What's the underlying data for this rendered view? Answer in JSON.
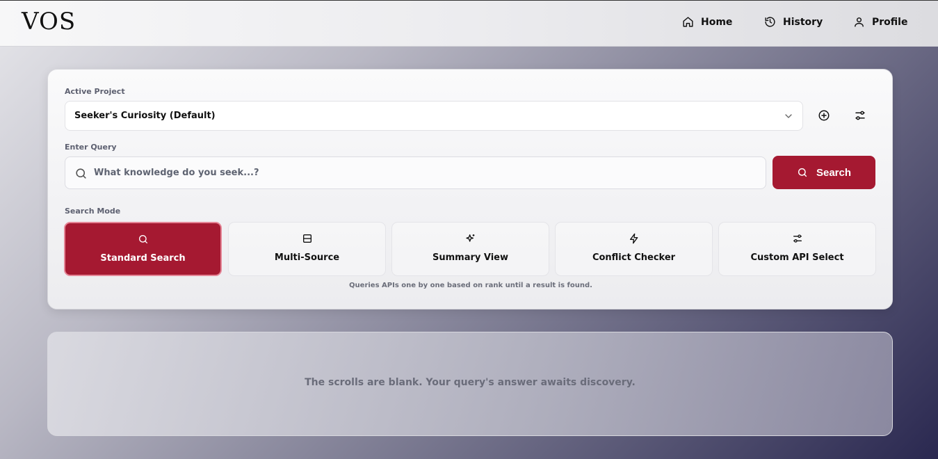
{
  "header": {
    "logo": "VOS",
    "nav": [
      {
        "label": "Home",
        "icon": "home-icon"
      },
      {
        "label": "History",
        "icon": "history-icon"
      },
      {
        "label": "Profile",
        "icon": "user-icon"
      }
    ]
  },
  "project": {
    "label": "Active Project",
    "selected": "Seeker's Curiosity (Default)"
  },
  "query": {
    "label": "Enter Query",
    "placeholder": "What knowledge do you seek...?",
    "value": "",
    "search_label": "Search"
  },
  "modes": {
    "label": "Search Mode",
    "items": [
      {
        "label": "Standard Search",
        "icon": "search-icon",
        "active": true
      },
      {
        "label": "Multi-Source",
        "icon": "layers-icon",
        "active": false
      },
      {
        "label": "Summary View",
        "icon": "sparkles-icon",
        "active": false
      },
      {
        "label": "Conflict Checker",
        "icon": "bolt-icon",
        "active": false
      },
      {
        "label": "Custom API Select",
        "icon": "sliders-icon",
        "active": false
      }
    ],
    "hint": "Queries APIs one by one based on rank until a result is found."
  },
  "result": {
    "empty_message": "The scrolls are blank. Your query's answer awaits discovery."
  },
  "colors": {
    "accent": "#a51931",
    "text": "#111111",
    "muted": "#5d6070"
  }
}
